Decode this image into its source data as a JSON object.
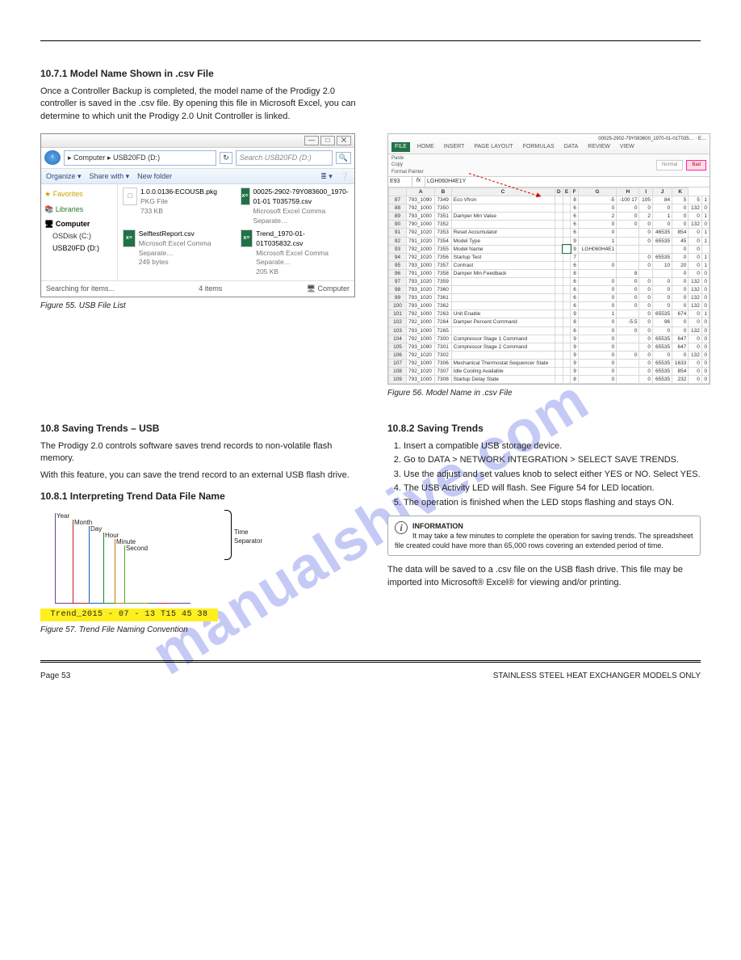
{
  "watermark": "manualshive.com",
  "section1": {
    "num": "10.7.1",
    "title": "Model Name Shown in .csv File"
  },
  "para1": "Once a Controller Backup is completed, the model name of the Prodigy 2.0 controller is saved in the .csv file. By opening this file in Microsoft Excel, you can determine to which unit the Prodigy 2.0 Unit Controller is linked.",
  "explorer": {
    "win": {
      "min": "—",
      "max": "□",
      "close": "⨉"
    },
    "nav_back": "‹",
    "path": "▸ Computer ▸ USB20FD (D:)",
    "search_placeholder": "Search USB20FD (D:)",
    "refresh": "↻",
    "toolbar": {
      "organize": "Organize ▾",
      "share": "Share with ▾",
      "new": "New folder"
    },
    "nav": {
      "fav": "★ Favorites",
      "lib": "📚 Libraries",
      "comp": "🖥 Computer",
      "osdisk": "OSDisk (C:)",
      "usb": "USB20FD (D:)"
    },
    "files": [
      {
        "icon": "pkg",
        "name": "1.0.0.0136-ECOUSB.pkg",
        "meta1": "PKG File",
        "meta2": "733 KB"
      },
      {
        "icon": "xl",
        "name": "00025-2902-79Y083600_1970-01-01 T035759.csv",
        "meta1": "Microsoft Excel Comma Separate…"
      },
      {
        "icon": "xl",
        "name": "SelftestReport.csv",
        "meta1": "Microsoft Excel Comma Separate…",
        "meta2": "249 bytes"
      },
      {
        "icon": "xl",
        "name": "Trend_1970-01-01T035832.csv",
        "meta1": "Microsoft Excel Comma Separate…",
        "meta2": "205 KB"
      }
    ],
    "status_left": "Searching for items...",
    "status_items": "4 items",
    "status_right": "🖥 Computer"
  },
  "fig55_cap": "Figure 55. USB File List",
  "excel": {
    "filetitle": "00025-2902-79Y083600_1970-01-01T035… · E…",
    "tabs": [
      "FILE",
      "HOME",
      "INSERT",
      "PAGE LAYOUT",
      "FORMULAS",
      "DATA",
      "REVIEW",
      "VIEW"
    ],
    "ribbon_items": {
      "paste": "Paste",
      "copy": "Copy",
      "fmtpainter": "Format Painter",
      "normal": "Normal",
      "bad": "Bad"
    },
    "namebox": "E93",
    "formula": "LGH060H4E1Y",
    "cols": [
      "",
      "A",
      "B",
      "C",
      "D",
      "E",
      "F",
      "G",
      "H",
      "I",
      "J",
      "K"
    ],
    "rows": [
      [
        "87",
        "793_1090",
        "7349",
        "Eco Vfron",
        "",
        "",
        "8",
        "-5",
        "-100 17",
        "105",
        "84",
        "5",
        "5",
        "1"
      ],
      [
        "88",
        "792_1000",
        "7350",
        "",
        "",
        "",
        "6",
        "0",
        "0",
        "0",
        "0",
        "0",
        "132",
        "0"
      ],
      [
        "89",
        "793_1000",
        "7351",
        "Damper Min Value",
        "",
        "",
        "6",
        "2",
        "0",
        "2",
        "1",
        "0",
        "0",
        "1"
      ],
      [
        "90",
        "790_1000",
        "7352",
        "",
        "",
        "",
        "6",
        "0",
        "0",
        "0",
        "0",
        "0",
        "132",
        "0"
      ],
      [
        "91",
        "792_1020",
        "7353",
        "Reset Accumulator",
        "",
        "",
        "6",
        "0",
        "",
        "0",
        "46535",
        "854",
        "0",
        "1"
      ],
      [
        "92",
        "791_1020",
        "7354",
        "Model Type",
        "",
        "",
        "9",
        "1",
        "",
        "0",
        "65535",
        "45",
        "0",
        "1"
      ],
      [
        "93",
        "792_1000",
        "7355",
        "Model Name",
        "",
        "",
        "9",
        "LGH060H4E1",
        "",
        "",
        "",
        "0",
        "0"
      ],
      [
        "94",
        "792_1020",
        "7356",
        "Startup Test",
        "",
        "",
        "7",
        "",
        "",
        "0",
        "65535",
        "0",
        "0",
        "1"
      ],
      [
        "95",
        "793_1000",
        "7357",
        "Contrast",
        "",
        "",
        "6",
        "0",
        "",
        "0",
        "10",
        "20",
        "0",
        "1"
      ],
      [
        "96",
        "791_1000",
        "7358",
        "Damper Min Feedback",
        "",
        "",
        "8",
        "",
        "8",
        "",
        "",
        "0",
        "0",
        "0"
      ],
      [
        "97",
        "793_1020",
        "7359",
        "",
        "",
        "",
        "6",
        "0",
        "0",
        "0",
        "0",
        "0",
        "132",
        "0"
      ],
      [
        "98",
        "793_1020",
        "7360",
        "",
        "",
        "",
        "6",
        "0",
        "0",
        "0",
        "0",
        "0",
        "132",
        "0"
      ],
      [
        "99",
        "793_1020",
        "7361",
        "",
        "",
        "",
        "6",
        "0",
        "0",
        "0",
        "0",
        "0",
        "132",
        "0"
      ],
      [
        "100",
        "793_1000",
        "7362",
        "",
        "",
        "",
        "6",
        "0",
        "0",
        "0",
        "0",
        "0",
        "132",
        "0"
      ],
      [
        "101",
        "792_1000",
        "7263",
        "Unit Enable",
        "",
        "",
        "9",
        "1",
        "",
        "0",
        "65535",
        "674",
        "0",
        "1"
      ],
      [
        "102",
        "792_1000",
        "7264",
        "Damper Percent Command",
        "",
        "",
        "8",
        "0",
        "-5.5",
        "0",
        "96",
        "0",
        "0",
        "0"
      ],
      [
        "103",
        "793_1000",
        "7265",
        "",
        "",
        "",
        "6",
        "0",
        "0",
        "0",
        "0",
        "0",
        "132",
        "0"
      ],
      [
        "104",
        "792_1000",
        "7300",
        "Compressor Stage 1 Command",
        "",
        "",
        "9",
        "0",
        "",
        "0",
        "65535",
        "647",
        "0",
        "0"
      ],
      [
        "105",
        "793_1090",
        "7301",
        "Compressor Stage 2 Command",
        "",
        "",
        "9",
        "0",
        "",
        "0",
        "65535",
        "647",
        "0",
        "0"
      ],
      [
        "106",
        "792_1020",
        "7302",
        "",
        "",
        "",
        "9",
        "0",
        "0",
        "0",
        "0",
        "0",
        "132",
        "0"
      ],
      [
        "107",
        "792_1000",
        "7306",
        "Mechanical Thermostat Sequencer State",
        "",
        "",
        "9",
        "0",
        "",
        "0",
        "65535",
        "1633",
        "0",
        "0"
      ],
      [
        "108",
        "792_1020",
        "7307",
        "Idle Cooling Available",
        "",
        "",
        "9",
        "0",
        "",
        "0",
        "65535",
        "854",
        "0",
        "0"
      ],
      [
        "109",
        "793_1000",
        "7308",
        "Startup Delay State",
        "",
        "",
        "8",
        "0",
        "",
        "0",
        "65535",
        "232",
        "0",
        "0"
      ]
    ],
    "selected_row": 6
  },
  "fig56_cap": "Figure 56. Model Name in .csv File",
  "section2": {
    "num": "10.8",
    "title": "Saving Trends – USB"
  },
  "para2": "The Prodigy 2.0 controls software saves trend records to non-volatile flash memory.",
  "para3": "With this feature, you can save the trend record to an external USB flash drive.",
  "section3": {
    "num": "10.8.1",
    "title": "Interpreting Trend Data File Name"
  },
  "fig57": {
    "highlight": "Trend_2015 - 07 - 13 T15 45 38",
    "labels": {
      "sec": "Second",
      "min": "Minute",
      "hour": "Hour",
      "day": "Day",
      "month": "Month",
      "year": "Year"
    },
    "brace": "Time Separator"
  },
  "fig57_cap": "Figure 57. Trend File Naming Convention",
  "section4": {
    "num": "10.8.2",
    "title": "Saving Trends"
  },
  "steps": [
    "Insert a compatible USB storage device.",
    "Go to DATA > NETWORK INTEGRATION > SELECT SAVE TRENDS.",
    "Use the adjust and set values knob to select either YES or NO. Select YES.",
    "The USB Activity LED will flash. See Figure 54 for LED location.",
    "The operation is finished when the LED stops flashing and stays ON."
  ],
  "info": {
    "label": "INFORMATION",
    "text": "It may take a few minutes to complete the operation for saving trends. The spreadsheet file created could have more than 65,000 rows covering an extended period of time."
  },
  "para4": "The data will be saved to a .csv file on the USB flash drive. This file may be imported into Microsoft® Excel® for viewing and/or printing.",
  "footer": {
    "page": "Page 53",
    "right": "STAINLESS STEEL HEAT EXCHANGER MODELS ONLY"
  }
}
